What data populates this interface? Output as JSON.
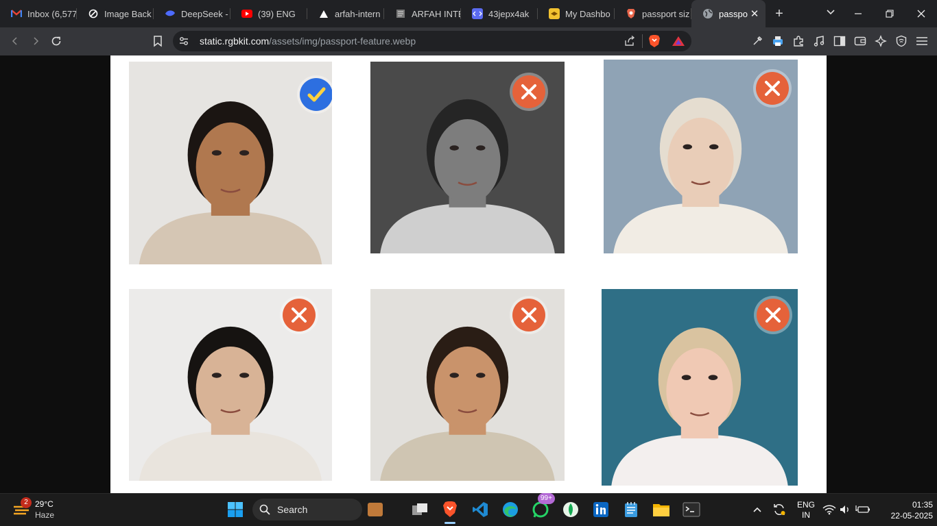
{
  "browser": {
    "tabs": [
      {
        "title": "Inbox (6,577",
        "icon": "gmail-icon",
        "color": "#ea4335"
      },
      {
        "title": "Image Back",
        "icon": "remove-bg-icon",
        "color": "#ffffff"
      },
      {
        "title": "DeepSeek -",
        "icon": "deepseek-icon",
        "color": "#4d6bfe"
      },
      {
        "title": "(39) ENG",
        "icon": "youtube-icon",
        "color": "#ff0000"
      },
      {
        "title": "arfah-intern",
        "icon": "vercel-icon",
        "color": "#ffffff"
      },
      {
        "title": "ARFAH INTE",
        "icon": "document-icon",
        "color": "#9aa0a6"
      },
      {
        "title": "43jepx4ak",
        "icon": "code-icon",
        "color": "#5b6bf0"
      },
      {
        "title": "My Dashbo",
        "icon": "dashboard-icon",
        "color": "#f2c230"
      },
      {
        "title": "passport siz",
        "icon": "brave-search-icon",
        "color": "#e8654a"
      },
      {
        "title": "passpo",
        "icon": "globe-icon",
        "color": "#bdc1c6"
      }
    ],
    "active_tab": 9,
    "url_host": "static.rgbkit.com",
    "url_path": "/assets/img/passport-feature.webp"
  },
  "page": {
    "photos": [
      {
        "name": "photo-man-approved",
        "status": "accepted",
        "bg": "#e6e4e1",
        "skin": "#b0784f",
        "hair": "#1b1512",
        "cloth": "#d5c6b4"
      },
      {
        "name": "photo-girl-grayscale",
        "status": "rejected",
        "bg": "#4a4a4a",
        "skin": "#7d7d7d",
        "hair": "#252525",
        "cloth": "#cfcfcf"
      },
      {
        "name": "photo-woman-hood",
        "status": "rejected",
        "bg": "#8fa3b5",
        "skin": "#e9cdb8",
        "hair": "#e5ddd0",
        "cloth": "#f1ece4"
      },
      {
        "name": "photo-man-glasses",
        "status": "rejected",
        "bg": "#ecebea",
        "skin": "#d8b396",
        "hair": "#161311",
        "cloth": "#e9e4dd"
      },
      {
        "name": "photo-man-beard",
        "status": "rejected",
        "bg": "#e2e0dc",
        "skin": "#c9936b",
        "hair": "#2a1d15",
        "cloth": "#cfc5b2"
      },
      {
        "name": "photo-girl-choker",
        "status": "rejected",
        "bg": "#2f6f86",
        "skin": "#f0c9b4",
        "hair": "#d9c3a0",
        "cloth": "#f3efee"
      }
    ]
  },
  "taskbar": {
    "weather_temp": "29°C",
    "weather_desc": "Haze",
    "weather_badge": "2",
    "search_label": "Search",
    "whatsapp_badge": "99+",
    "lang_top": "ENG",
    "lang_bottom": "IN",
    "time": "01:35",
    "date": "22-05-2025"
  }
}
